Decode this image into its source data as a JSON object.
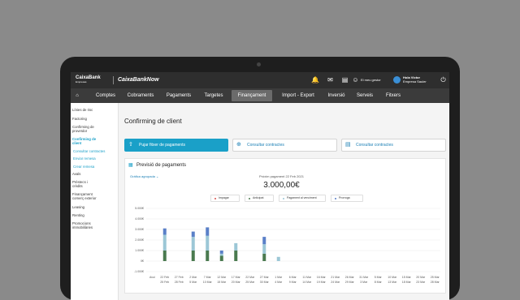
{
  "topbar": {
    "brand": "CaixaBank",
    "brand_sub": "Empresas",
    "product": "CaixaBankNow",
    "gestor": "El meu gestor",
    "user_greeting": "Hola Victor",
    "user_company": "Empresa Sauler"
  },
  "nav": {
    "items": [
      "Comptes",
      "Cobraments",
      "Pagaments",
      "Targetes",
      "Finançament",
      "Import - Export",
      "Inversió",
      "Serveis",
      "Fitxers"
    ],
    "active": "Finançament"
  },
  "sidebar": {
    "items": [
      {
        "label": "Línies de risc"
      },
      {
        "label": "Factoring"
      },
      {
        "label": "Confirming de proveïdor"
      },
      {
        "label": "Confirming de client"
      },
      {
        "label": "Consultar contractes"
      },
      {
        "label": "Enviar remesa"
      },
      {
        "label": "Crear remesa"
      },
      {
        "label": "Avals"
      },
      {
        "label": "Préstecs i crèdits"
      },
      {
        "label": "Finançament comerç exterior"
      },
      {
        "label": "Leasing"
      },
      {
        "label": "Renting"
      },
      {
        "label": "Promocions immobiliàries"
      }
    ]
  },
  "page": {
    "title": "Confirming de client",
    "actions": [
      "Pujar fitxer de pagaments",
      "Consultar contractes",
      "Consultar contractes"
    ]
  },
  "forecast": {
    "title": "Previsió de pagaments",
    "view_selector": "Gràfica agrupada",
    "next_payment_label": "Pròxim pagament",
    "next_payment_date": "22 Feb 2021",
    "amount": "3.000,00€"
  },
  "colors": {
    "accent": "#1aa0c8",
    "impagat": "#d9534f",
    "anticipat": "#4a7a4f",
    "venciment": "#9cc7d6",
    "prorroga": "#5a80c8"
  },
  "chart_data": {
    "type": "bar",
    "stacked": true,
    "legend": [
      "Impagar",
      "Anticipat",
      "Pagament al venciment",
      "Prorroga"
    ],
    "y_ticks": [
      "5.000€",
      "4.000€",
      "3.000€",
      "2.000€",
      "1.000€",
      "0€",
      "-1.000€"
    ],
    "ylim": [
      -1000,
      5000
    ],
    "x_prefix": "Avui",
    "categories": [
      "22 Feb",
      "27 Feb",
      "2 Mar",
      "7 Mar",
      "12 Mar",
      "17 Mar",
      "22 Mar",
      "27 Mar",
      "1 Mar",
      "6 Mar",
      "11 Mar",
      "16 Mar",
      "21 Mar",
      "26 Mar",
      "31 Mar",
      "5 Mar",
      "10 Mar",
      "15 Mar",
      "20 Mar",
      "25 Mar"
    ],
    "x_second_row": [
      "25 Feb",
      "28 Feb",
      "5 Mar",
      "10 Mar",
      "15 Mar",
      "20 Mar",
      "25 Mar",
      "30 Mar",
      "4 Mar",
      "9 Mar",
      "14 Mar",
      "19 Mar",
      "24 Mar",
      "29 Mar",
      "3 Mar",
      "8 Mar",
      "13 Mar",
      "18 Mar",
      "23 Mar",
      "28 Mar"
    ],
    "series": [
      {
        "name": "Anticipat",
        "values": [
          1000,
          0,
          1000,
          1000,
          500,
          1000,
          0,
          700,
          0,
          0,
          0,
          0,
          0,
          0,
          0,
          0,
          0,
          0,
          0,
          0
        ]
      },
      {
        "name": "Pagament al venciment",
        "values": [
          1500,
          0,
          1300,
          1400,
          200,
          700,
          0,
          900,
          400,
          0,
          0,
          0,
          0,
          0,
          0,
          0,
          0,
          0,
          0,
          0
        ]
      },
      {
        "name": "Prorroga",
        "values": [
          600,
          0,
          500,
          800,
          300,
          0,
          0,
          700,
          0,
          0,
          0,
          0,
          0,
          0,
          0,
          0,
          0,
          0,
          0,
          0
        ]
      }
    ]
  }
}
